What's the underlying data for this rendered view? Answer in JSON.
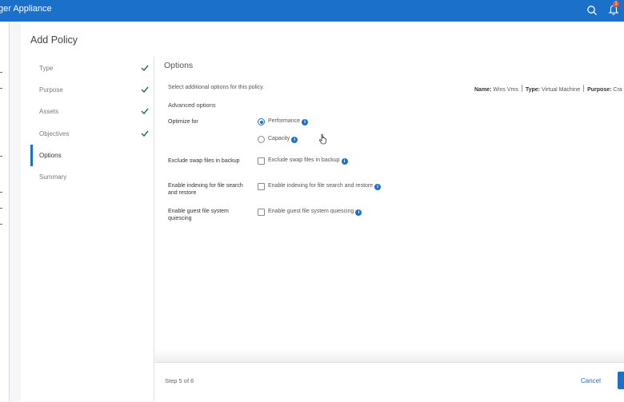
{
  "header": {
    "app_title": "ger Appliance",
    "notification_count": "1",
    "icons": [
      "search-icon",
      "bell-icon"
    ]
  },
  "page": {
    "title": "Add Policy"
  },
  "steps": [
    {
      "label": "Type",
      "completed": true
    },
    {
      "label": "Purpose",
      "completed": true
    },
    {
      "label": "Assets",
      "completed": true
    },
    {
      "label": "Objectives",
      "completed": true
    },
    {
      "label": "Options",
      "completed": false,
      "active": true
    },
    {
      "label": "Summary",
      "completed": false
    }
  ],
  "options": {
    "title": "Options",
    "subtitle": "Select additional options for this policy.",
    "meta": {
      "name_label": "Name:",
      "name_value": "Wins Vms",
      "type_label": "Type:",
      "type_value": "Virtual Machine",
      "purpose_label": "Purpose:",
      "purpose_value": "Cra"
    },
    "advanced_label": "Advanced options",
    "optimize": {
      "label": "Optimize for",
      "choices": [
        "Performance",
        "Capacity"
      ],
      "selected": "Performance"
    },
    "swap": {
      "label": "Exclude swap files in backup",
      "checkbox_label": "Exclude swap files in backup",
      "checked": false
    },
    "indexing": {
      "label": "Enable indexing for file search and restore",
      "checkbox_label": "Enable indexing for file search and restore",
      "checked": false
    },
    "quiescing": {
      "label": "Enable guest file system quiescing",
      "checkbox_label": "Enable guest file system quiescing",
      "checked": false
    },
    "info_glyph": "i"
  },
  "footer": {
    "step_count": "Step 5 of 6",
    "cancel_label": "Cancel"
  },
  "colors": {
    "accent": "#1b70c9",
    "check": "#1f6e4a"
  }
}
